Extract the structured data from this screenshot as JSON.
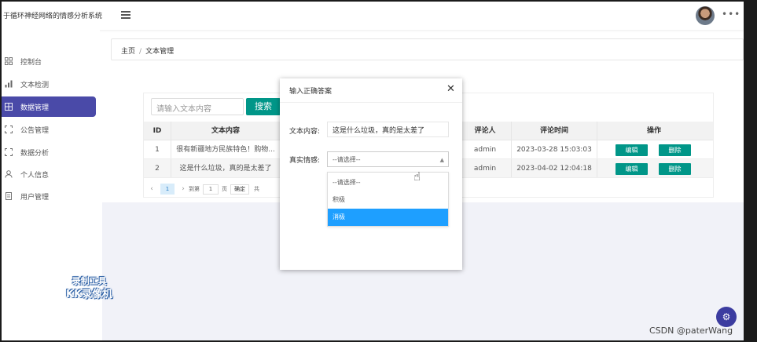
{
  "app": {
    "title": "于循环神经网络的情感分析系统"
  },
  "sidebar": {
    "items": [
      {
        "label": "控制台",
        "icon": "dashboard-icon",
        "active": false
      },
      {
        "label": "文本检测",
        "icon": "bar-chart-icon",
        "active": false
      },
      {
        "label": "数据管理",
        "icon": "grid-icon",
        "active": true
      },
      {
        "label": "公告管理",
        "icon": "expand-icon",
        "active": false
      },
      {
        "label": "数据分析",
        "icon": "expand-icon",
        "active": false
      },
      {
        "label": "个人信息",
        "icon": "user-icon",
        "active": false
      },
      {
        "label": "用户管理",
        "icon": "document-icon",
        "active": false
      }
    ]
  },
  "breadcrumb": {
    "home": "主页",
    "separator": "/",
    "current": "文本管理"
  },
  "search": {
    "placeholder": "请输入文本内容",
    "button": "搜索"
  },
  "table": {
    "headers": {
      "id": "ID",
      "content": "文本内容",
      "commenter": "评论人",
      "time": "评论时间",
      "actions": "操作"
    },
    "rows": [
      {
        "id": "1",
        "content": "很有新疆地方民族特色！购物...",
        "commenter": "admin",
        "time": "2023-03-28 15:03:03",
        "edit": "编辑",
        "delete": "删除"
      },
      {
        "id": "2",
        "content": "这是什么垃圾，真的是太差了",
        "commenter": "admin",
        "time": "2023-04-02 12:04:18",
        "edit": "编辑",
        "delete": "删除"
      }
    ]
  },
  "pager": {
    "current": "1",
    "goto_label": "到第",
    "goto_value": "1",
    "page_unit": "页",
    "confirm": "确定",
    "total_prefix": "共"
  },
  "modal": {
    "title": "输入正确答案",
    "text_label": "文本内容:",
    "text_value": "这是什么垃圾，真的是太差了",
    "emotion_label": "真实情感:",
    "select_value": "--请选择--",
    "options": [
      "--请选择--",
      "积极",
      "消极"
    ],
    "highlighted_option": "消极"
  },
  "overlay": {
    "watermark_line1": "录制工具",
    "watermark_line2": "KK录像机",
    "csdn": "CSDN @paterWang"
  },
  "colors": {
    "primary": "#009688",
    "sidebar_active": "#4a4aa8",
    "dropdown_highlight": "#1e9fff"
  }
}
